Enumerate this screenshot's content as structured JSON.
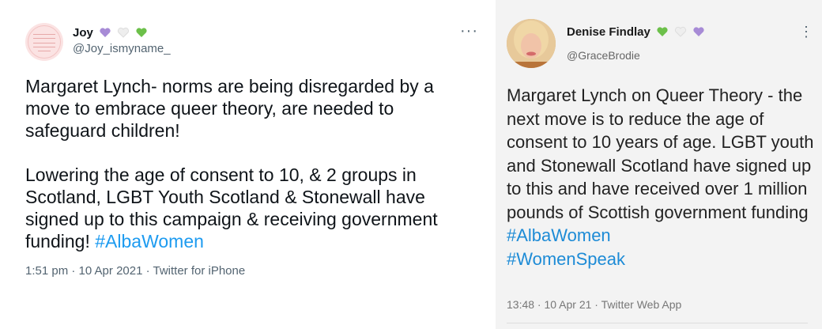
{
  "left": {
    "name": "Joy",
    "handle": "@Joy_ismyname_",
    "text_p1": "Margaret Lynch- norms are being disregarded by a move to embrace queer theory, are needed to safeguard children!",
    "text_p2": "Lowering the age of consent to 10, & 2 groups in Scotland, LGBT Youth Scotland & Stonewall have signed up to this campaign & receiving government funding!",
    "hashtag": "#AlbaWomen",
    "meta": "1:51 pm · 10 Apr 2021 · Twitter for iPhone",
    "more": "···",
    "name_emoji_colors": [
      "#a78bd6",
      "#e8e8e8",
      "#6cc04a"
    ]
  },
  "right": {
    "name": "Denise Findlay",
    "handle": "@GraceBrodie",
    "text": "Margaret Lynch on Queer Theory - the next move is to reduce the age of consent to 10 years of age. LGBT youth and Stonewall Scotland have signed up to this and have received over 1 million pounds of Scottish government funding",
    "hashtag1": "#AlbaWomen",
    "hashtag2": "#WomenSpeak",
    "meta": "13:48 · 10 Apr 21 · Twitter Web App",
    "more": "⋮",
    "name_emoji_colors": [
      "#6cc04a",
      "#e8e8e8",
      "#a78bd6"
    ]
  }
}
